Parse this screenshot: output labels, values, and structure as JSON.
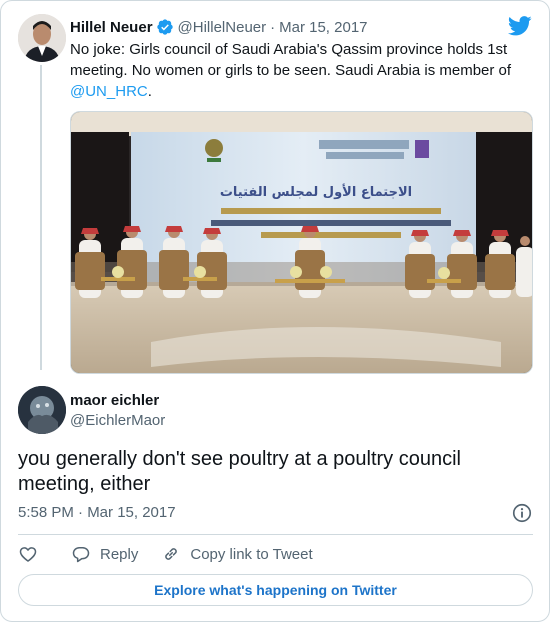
{
  "quoted_tweet": {
    "display_name": "Hillel Neuer",
    "handle": "@HillelNeuer",
    "separator": "·",
    "date": "Mar 15, 2017",
    "text_before": "No joke: Girls council of Saudi Arabia's Qassim province holds 1st meeting. No women or girls to be seen. Saudi Arabia is member of ",
    "mention": "@UN_HRC",
    "text_after": ".",
    "verified_icon": "verified-badge-icon",
    "brand_icon": "twitter-bird-icon",
    "photo": {
      "banner_title_ar": "الاجتماع الأول لمجلس الفتيات",
      "banner_sub_ar": "الأمير الدكتور / فيصل بن مشعل بن سعود بن عبد العزيز",
      "banner_org_ar": "مجلس فتيات القصيم",
      "banner_org_en": "Qassim Girls Council"
    }
  },
  "reply_tweet": {
    "display_name": "maor eichler",
    "handle": "@EichlerMaor",
    "text": "you generally don't see poultry at a poultry council meeting, either",
    "timestamp": "5:58 PM · Mar 15, 2017",
    "info_icon": "info-icon"
  },
  "actions": {
    "like_icon": "heart-icon",
    "reply_label": "Reply",
    "copy_link_label": "Copy link to Tweet"
  },
  "explore_button_label": "Explore what's happening on Twitter",
  "colors": {
    "accent": "#1d9bf0",
    "text_primary": "#0f1419",
    "text_secondary": "#536471",
    "border": "#cfd9de"
  }
}
